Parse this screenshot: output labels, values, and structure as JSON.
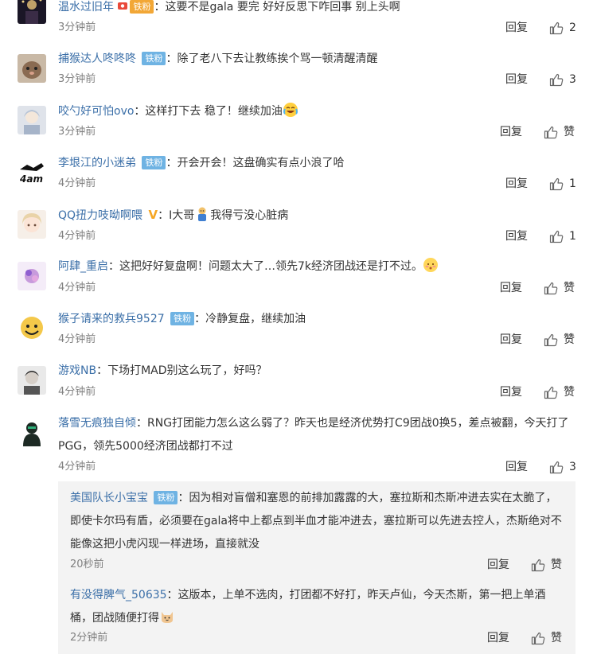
{
  "ui": {
    "reply_label": "回复",
    "like_label": "赞"
  },
  "comments": [
    {
      "user": "温水过旧年",
      "badge": "铁粉",
      "text": "这要不是gala 要完 好好反思下咋回事 别上头啊",
      "time": "3分钟前",
      "likes": "2"
    },
    {
      "user": "捕猴达人咚咚咚",
      "badge": "铁粉",
      "text": "除了老八下去让教练挨个骂一顿清醒清醒",
      "time": "3分钟前",
      "likes": "3"
    },
    {
      "user": "咬勺好可怕ovo",
      "badge": "",
      "text": "这样打下去 稳了！继续加油",
      "time": "3分钟前",
      "likes": ""
    },
    {
      "user": "李垠江的小迷弟",
      "badge": "铁粉",
      "text": "开会开会！这盘确实有点小浪了哈",
      "time": "4分钟前",
      "likes": "1"
    },
    {
      "user": "QQ扭力吱呦啊喂",
      "badge": "",
      "text_before": "I大哥",
      "text_after": "我得亏没心脏病",
      "time": "4分钟前",
      "likes": "1"
    },
    {
      "user": "阿肆_重启",
      "badge": "",
      "text": "这把好好复盘啊！问题太大了…领先7k经济团战还是打不过。",
      "time": "4分钟前",
      "likes": ""
    },
    {
      "user": "猴子请来的救兵9527",
      "badge": "铁粉",
      "text": "冷静复盘，继续加油",
      "time": "4分钟前",
      "likes": ""
    },
    {
      "user": "游戏NB",
      "badge": "",
      "text": "下场打MAD别这么玩了，好吗？",
      "time": "4分钟前",
      "likes": ""
    },
    {
      "user": "落雪无痕独自倾",
      "badge": "",
      "text": "RNG打团能力怎么这么弱了？昨天也是经济优势打C9团战0换5，差点被翻，今天打了PGG，领先5000经济团战都打不过",
      "time": "4分钟前",
      "likes": "3"
    }
  ],
  "replies": [
    {
      "user": "美国队长小宝宝",
      "badge": "铁粉",
      "text": "因为相对盲僧和塞恩的前排加露露的大，塞拉斯和杰斯冲进去实在太脆了，即使卡尔玛有盾，必须要在gala将中上都点到半血才能冲进去，塞拉斯可以先进去控人，杰斯绝对不能像这把小虎闪现一样进场，直接就没",
      "time": "20秒前",
      "likes": ""
    },
    {
      "user": "有没得脾气_50635",
      "badge": "",
      "text": "这版本，上单不选肉，打团都不好打，昨天卢仙，今天杰斯，第一把上单酒桶，团战随便打得",
      "time": "2分钟前",
      "likes": ""
    }
  ],
  "colors": {
    "username": "#3b6fa8",
    "badge_fan": "#6fb3e3",
    "badge_gold": "#f2a736",
    "meta": "#808080",
    "reply_box": "#f3f3f3"
  },
  "icons": [
    "thumbs-up-icon",
    "laughing-cry-emoji",
    "doge-figure-emoji",
    "blush-emoji",
    "cat-emoji",
    "verified-v-icon"
  ]
}
